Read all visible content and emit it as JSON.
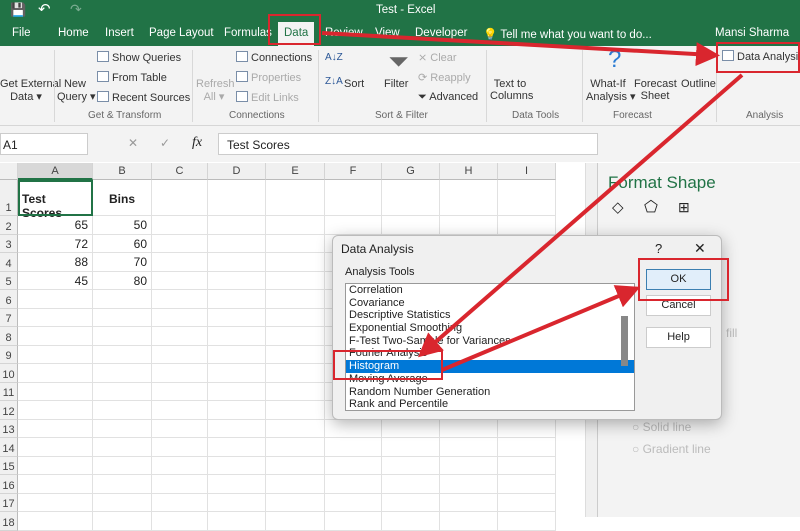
{
  "window": {
    "title": "Test - Excel",
    "user": "Mansi Sharma",
    "tell_me": "Tell me what you want to do..."
  },
  "tabs": [
    "File",
    "Home",
    "Insert",
    "Page Layout",
    "Formulas",
    "Data",
    "Review",
    "View",
    "Developer"
  ],
  "ribbon": {
    "get_external": [
      "Get External",
      "Data ▾"
    ],
    "new_query": [
      "New",
      "Query ▾"
    ],
    "show_queries": "Show Queries",
    "from_table": "From Table",
    "recent_sources": "Recent Sources",
    "refresh": [
      "Refresh",
      "All ▾"
    ],
    "connections": "Connections",
    "properties": "Properties",
    "edit_links": "Edit Links",
    "sort": "Sort",
    "filter": "Filter",
    "clear": "Clear",
    "reapply": "Reapply",
    "advanced": "Advanced",
    "text_to_columns": [
      "Text to",
      "Columns"
    ],
    "what_if": [
      "What-If",
      "Analysis ▾"
    ],
    "forecast_sheet": [
      "Forecast",
      "Sheet"
    ],
    "outline": "Outline",
    "data_analysis": "Data Analysis",
    "groups": [
      "Get & Transform",
      "Connections",
      "Sort & Filter",
      "Data Tools",
      "Forecast",
      "Analysis"
    ]
  },
  "formula_bar": {
    "name_box": "A1",
    "fx": "fx",
    "value": "Test Scores"
  },
  "sheet": {
    "columns": [
      "A",
      "B",
      "C",
      "D",
      "E",
      "F",
      "G",
      "H",
      "I"
    ],
    "rows": [
      "1",
      "2",
      "3",
      "4",
      "5",
      "6",
      "7",
      "8",
      "9",
      "10",
      "11",
      "12",
      "13",
      "14",
      "15",
      "16",
      "17",
      "18"
    ],
    "cells": [
      [
        "Test Scores",
        "Bins"
      ],
      [
        "65",
        "50"
      ],
      [
        "72",
        "60"
      ],
      [
        "88",
        "70"
      ],
      [
        "45",
        "80"
      ]
    ]
  },
  "format_pane": {
    "title": "Format Shape",
    "fill_label": "fill",
    "solid_line": "Solid line",
    "gradient_line": "Gradient line"
  },
  "dialog": {
    "title": "Data Analysis",
    "help": "?",
    "close": "✕",
    "list_label": "Analysis Tools",
    "tools": [
      "Correlation",
      "Covariance",
      "Descriptive Statistics",
      "Exponential Smoothing",
      "F-Test Two-Sample for Variances",
      "Fourier Analysis",
      "Histogram",
      "Moving Average",
      "Random Number Generation",
      "Rank and Percentile"
    ],
    "selected": "Histogram",
    "ok": "OK",
    "cancel": "Cancel",
    "help_btn": "Help"
  }
}
